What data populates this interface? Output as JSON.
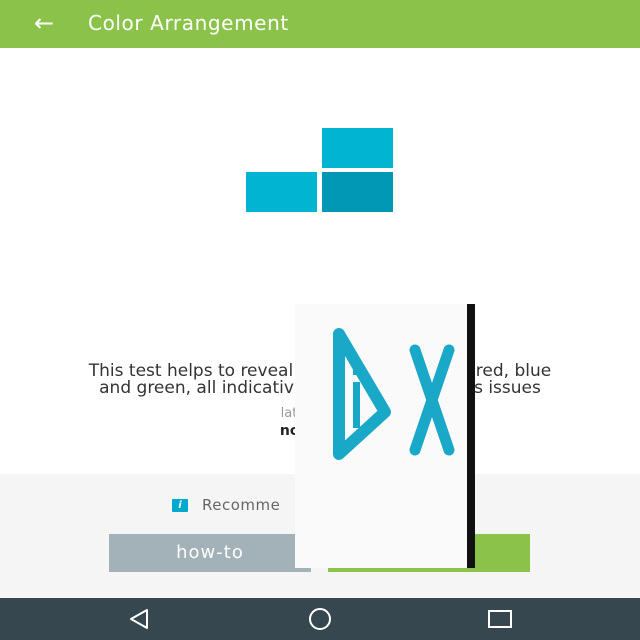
{
  "header": {
    "title": "Color Arrangement",
    "back_icon": "arrow-left-icon"
  },
  "colors": {
    "appbar": "#8bc34a",
    "accent": "#00b4d2",
    "accent_dark": "#0098b5",
    "howto_button": "#a3b1b8",
    "navbar": "#37474f"
  },
  "main": {
    "logo_icon": "color-blocks-icon",
    "description_line1_left": "This test helps to reveal",
    "description_line1_right": "of red, blue",
    "description_line2_left": "and green, all indicativ",
    "description_line2_right": "ess issues",
    "note_small": "late",
    "note_bold": "not"
  },
  "bottom": {
    "recommend_icon": "info-icon",
    "recommend_text": "Recomme",
    "howto_label": "how-to",
    "start_label": ""
  },
  "ad_overlay": {
    "icon": "dx-logo-icon"
  },
  "navbar": {
    "back_icon": "triangle-back-icon",
    "home_icon": "circle-home-icon",
    "recent_icon": "square-recent-icon"
  }
}
